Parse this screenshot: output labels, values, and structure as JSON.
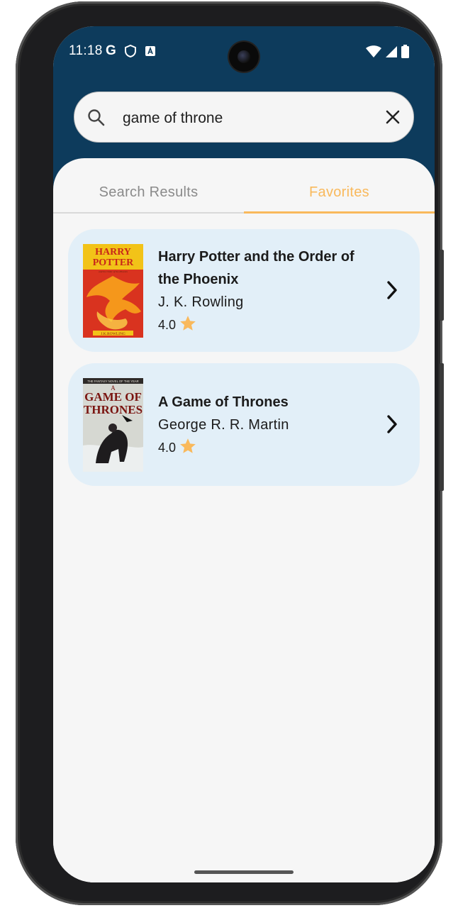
{
  "status_bar": {
    "time": "11:18",
    "left_icons": [
      "g-icon",
      "shield-icon",
      "font-icon"
    ],
    "right_icons": [
      "wifi-icon",
      "signal-icon",
      "battery-icon"
    ]
  },
  "search": {
    "value": "game of throne",
    "placeholder": ""
  },
  "tabs": [
    {
      "label": "Search Results",
      "active": false
    },
    {
      "label": "Favorites",
      "active": true
    }
  ],
  "books": [
    {
      "title": "Harry Potter and the Order of the Phoenix",
      "author": "J. K. Rowling",
      "rating": "4.0",
      "cover_text": [
        "HARRY",
        "POTTER",
        "and the Order of the Phoenix",
        "J.K.ROWLING"
      ]
    },
    {
      "title": "A Game of Thrones",
      "author": "George R. R. Martin",
      "rating": "4.0",
      "cover_text": [
        "THE FANTASY NOVEL OF THE YEAR",
        "A",
        "GAME OF",
        "THRONES"
      ]
    }
  ],
  "colors": {
    "header_bg": "#0d3b5c",
    "accent": "#f9b95c",
    "card_bg": "#e2eff8",
    "page_bg": "#f6f6f6"
  }
}
